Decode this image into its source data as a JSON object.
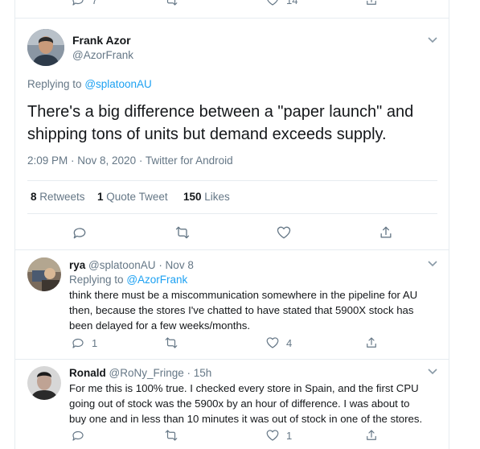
{
  "top_actions": {
    "reply_count": "7",
    "like_count": "14"
  },
  "main_tweet": {
    "author_name": "Frank Azor",
    "author_handle": "@AzorFrank",
    "replying_label": "Replying to",
    "replying_handle": "@splatoonAU",
    "text_line1": "There's a big difference between a \"paper launch\" and",
    "text_line2": "shipping tons of units but demand exceeds supply.",
    "meta": "2:09 PM · Nov 8, 2020 · Twitter for Android",
    "retweets_count": "8",
    "retweets_label": "Retweets",
    "quotes_count": "1",
    "quotes_label": "Quote Tweet",
    "likes_count": "150",
    "likes_label": "Likes"
  },
  "replies": [
    {
      "author_name": "rya",
      "author_handle": "@splatoonAU",
      "date": "· Nov 8",
      "replying_label": "Replying to",
      "replying_handle": "@AzorFrank",
      "lines": [
        "think there must be a miscommunication somewhere in the pipeline for AU",
        "then, because the stores I've chatted to have stated that 5900X stock has",
        "been delayed for a few weeks/months."
      ],
      "reply_count": "1",
      "like_count": "4"
    },
    {
      "author_name": "Ronald",
      "author_handle": "@RoNy_Fringe",
      "date": "· 15h",
      "lines": [
        "For me this is 100% true. I checked every store in Spain, and the first CPU",
        "going out of stock was the 5900x by an hour of difference. I was about to",
        "buy one and in less than 10 minutes it was out of stock in one of the stores."
      ],
      "reply_count": "",
      "like_count": "1"
    }
  ],
  "colors": {
    "accent": "#1da1f2",
    "muted": "#657786",
    "border": "#e6ecf0",
    "text": "#14171a"
  }
}
